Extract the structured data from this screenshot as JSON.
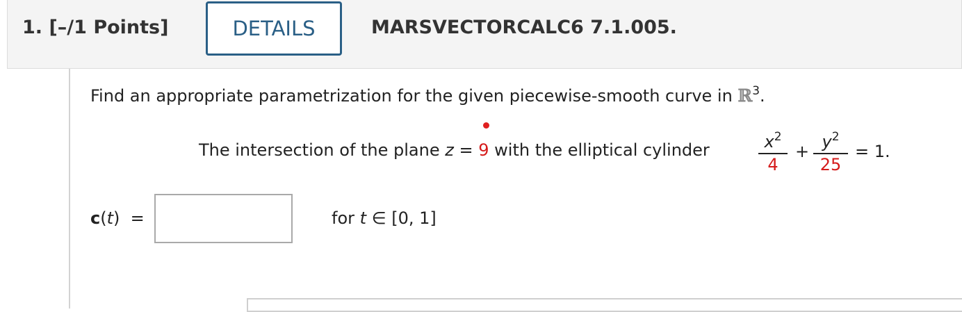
{
  "header": {
    "question_number": "1.",
    "points": "[–/1 Points]",
    "details_label": "DETAILS",
    "question_code": "MARSVECTORCALC6 7.1.005."
  },
  "prompt": {
    "text": "Find an appropriate parametrization for the given piecewise-smooth curve in ",
    "space_symbol": "ℝ",
    "space_exponent": "3",
    "end": "."
  },
  "statement": {
    "text_before": "The intersection of the plane ",
    "variable_z": "z",
    "equals": " = ",
    "plane_value": "9",
    "text_after": " with the elliptical cylinder",
    "frac1_num_var": "x",
    "frac1_num_exp": "2",
    "frac1_den": "4",
    "plus": "+",
    "frac2_num_var": "y",
    "frac2_num_exp": "2",
    "frac2_den": "25",
    "rhs": "= 1."
  },
  "answer": {
    "func_name": "c",
    "paren_open": "(",
    "func_var": "t",
    "paren_close": ")",
    "equals": "=",
    "value": "",
    "domain_prefix": "for ",
    "domain_var": "t",
    "domain_in": " ∈ ",
    "domain_interval": "[0, 1]"
  },
  "colors": {
    "accent": "#2a5f86",
    "highlight_red": "#d51b1b"
  }
}
